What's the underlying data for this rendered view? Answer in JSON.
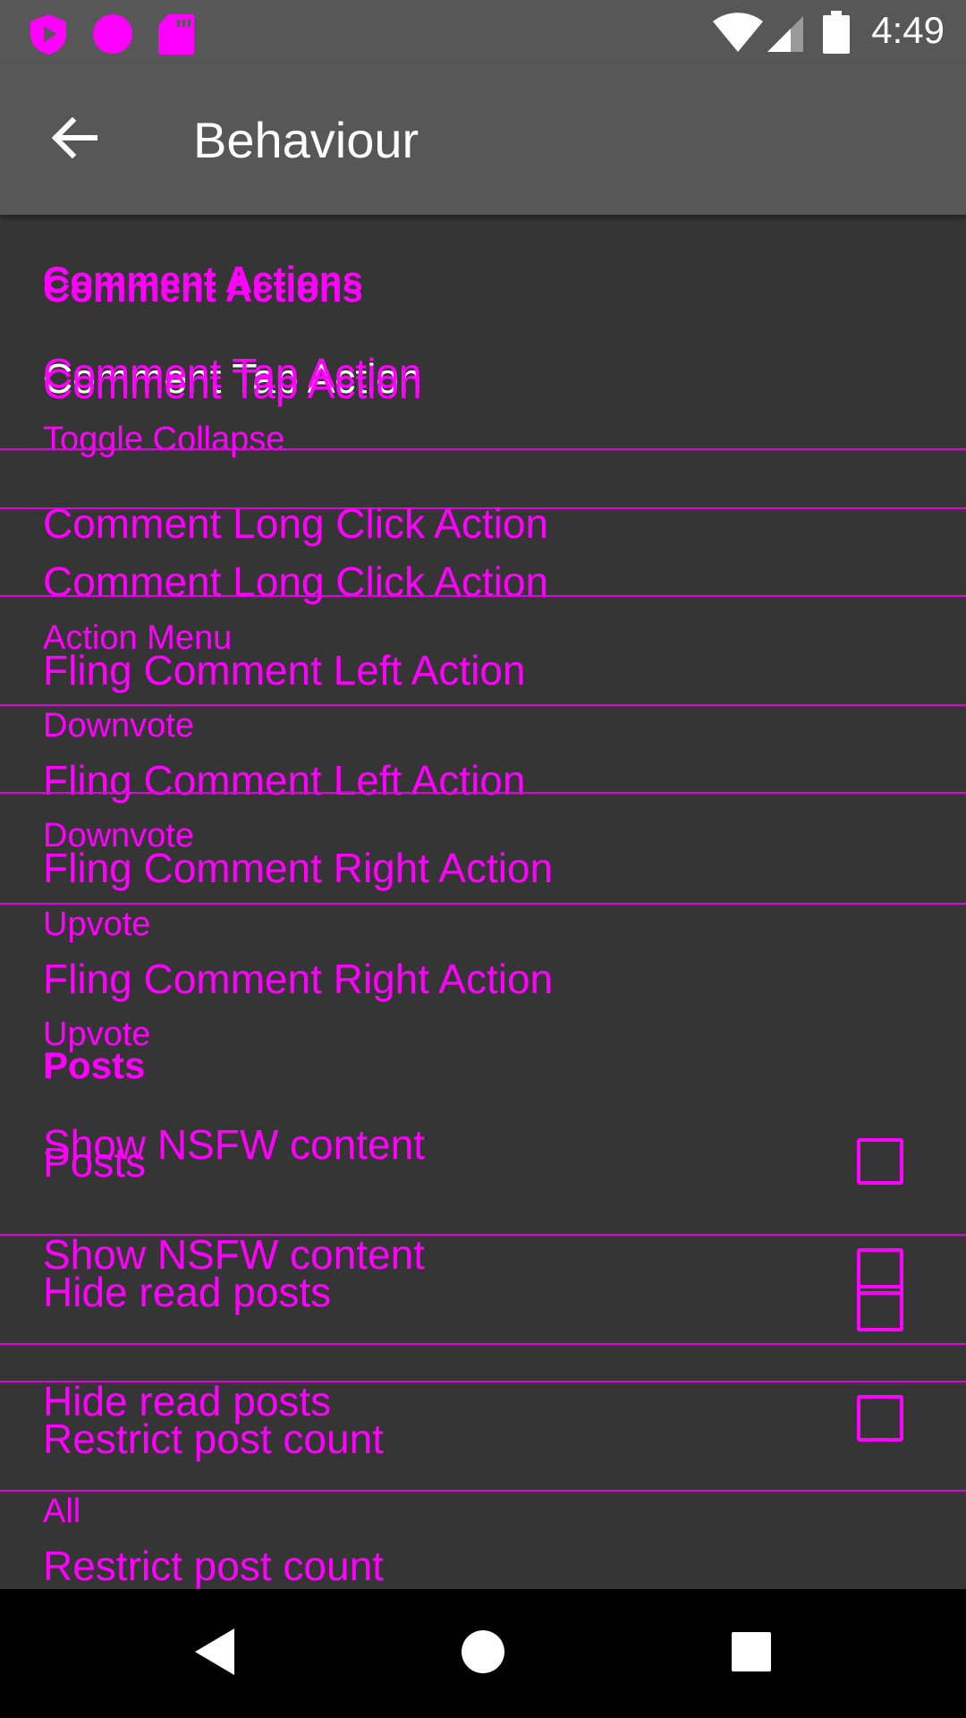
{
  "status_bar": {
    "time": "4:49",
    "left_icons": [
      "shield-play-icon",
      "circle-icon",
      "sd-card-icon"
    ],
    "right_icons": [
      "wifi-icon",
      "signal-icon",
      "battery-icon"
    ]
  },
  "app_bar": {
    "title": "Behaviour",
    "back_icon": "arrow-back-icon"
  },
  "settings": {
    "comment_actions_header": "Comment Actions",
    "comment_tap_action": {
      "title": "Comment Tap Action",
      "summary": "Toggle Collapse"
    },
    "comment_long_click_action": {
      "title": "Comment Long Click Action",
      "summary": "Action Menu"
    },
    "fling_comment_left_action": {
      "title": "Fling Comment Left Action",
      "summary": "Downvote"
    },
    "fling_comment_right_action": {
      "title": "Fling Comment Right Action",
      "summary": "Upvote"
    },
    "posts_header": "Posts",
    "show_nsfw_content": {
      "title": "Show NSFW content",
      "checked": false
    },
    "hide_read_posts": {
      "title": "Hide read posts",
      "checked": false
    },
    "restrict_post_count": {
      "title": "Restrict post count",
      "summary": "All"
    }
  },
  "nav_bar": {
    "back_icon": "nav-back-icon",
    "home_icon": "nav-home-icon",
    "recents_icon": "nav-recents-icon"
  },
  "colors": {
    "overlay_text": "#ff00ff",
    "background": "#353535",
    "app_bar": "#575757"
  }
}
